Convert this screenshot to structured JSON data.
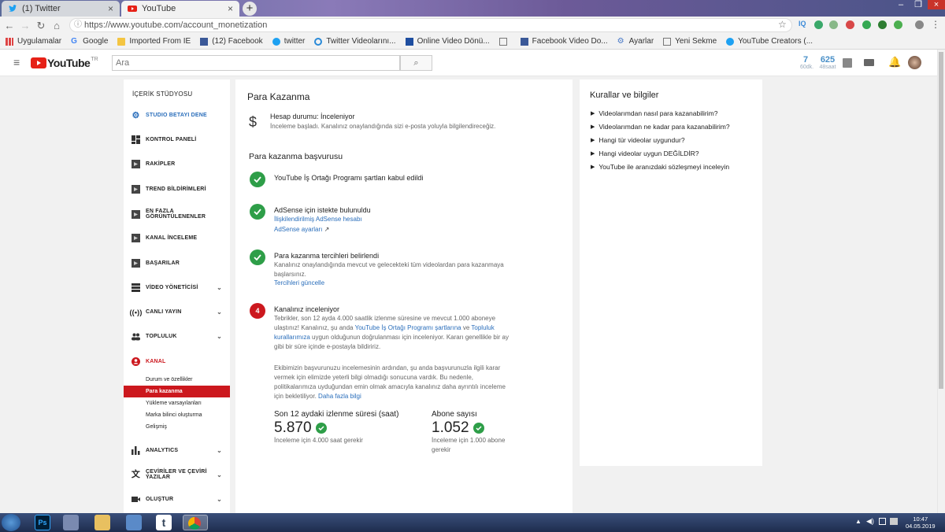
{
  "browser": {
    "tabs": [
      {
        "title": "(1) Twitter",
        "active": false
      },
      {
        "title": "YouTube",
        "active": true
      }
    ],
    "url": "https://www.youtube.com/account_monetization",
    "bookmarks": [
      "Uygulamalar",
      "Google",
      "Imported From IE",
      "(12) Facebook",
      "twitter",
      "Twitter Videolarını...",
      "Online Video Dönü...",
      "",
      "Facebook Video Do...",
      "Ayarlar",
      "Yeni Sekme",
      "YouTube Creators (..."
    ]
  },
  "yt": {
    "logo": "YouTube",
    "country": "TR",
    "search_placeholder": "Ara",
    "stats": [
      {
        "value": "7",
        "label": "60dk."
      },
      {
        "value": "625",
        "label": "48saat"
      }
    ]
  },
  "sidebar": {
    "heading": "İÇERİK STÜDYOSU",
    "items": [
      {
        "label": "STUDIO BETAYI DENE",
        "icon": "gear-icon"
      },
      {
        "label": "KONTROL PANELİ",
        "icon": "dashboard-icon"
      },
      {
        "label": "RAKİPLER",
        "icon": "video-thumb-icon"
      },
      {
        "label": "TREND BİLDİRİMLERİ",
        "icon": "video-thumb-icon"
      },
      {
        "label": "EN FAZLA GÖRÜNTÜLENENLER",
        "icon": "video-thumb-icon"
      },
      {
        "label": "KANAL İNCELEME",
        "icon": "video-thumb-icon"
      },
      {
        "label": "BAŞARILAR",
        "icon": "video-thumb-icon"
      },
      {
        "label": "VİDEO YÖNETİCİSİ",
        "icon": "list-icon"
      },
      {
        "label": "CANLI YAYIN",
        "icon": "broadcast-icon"
      },
      {
        "label": "TOPLULUK",
        "icon": "people-icon"
      },
      {
        "label": "KANAL",
        "icon": "account-icon"
      },
      {
        "label": "ANALYTICS",
        "icon": "bar-chart-icon"
      },
      {
        "label": "ÇEVİRİLER VE ÇEVİRİ YAZILAR",
        "icon": "translate-icon"
      },
      {
        "label": "OLUŞTUR",
        "icon": "camera-icon"
      }
    ],
    "kanal_sub": [
      "Durum ve özellikler",
      "Para kazanma",
      "Yükleme varsayılanları",
      "Marka bilinci oluşturma",
      "Gelişmiş"
    ]
  },
  "main": {
    "title": "Para Kazanma",
    "status_title": "Hesap durumu: İnceleniyor",
    "status_desc": "İnceleme başladı. Kanalınız onaylandığında sizi e-posta yoluyla bilgilendireceğiz.",
    "section_title": "Para kazanma başvurusu",
    "step1": "YouTube İş Ortağı Programı şartları kabul edildi",
    "step2_title": "AdSense için istekte bulunuldu",
    "step2_link1": "İlişkilendirilmiş AdSense hesabı",
    "step2_link2": "AdSense ayarları",
    "step3_title": "Para kazanma tercihleri belirlendi",
    "step3_desc": "Kanalınız onaylandığında mevcut ve gelecekteki tüm videolardan para kazanmaya başlarsınız.",
    "step3_link": "Tercihleri güncelle",
    "step4_num": "4",
    "step4_title": "Kanalınız inceleniyor",
    "step4_p1a": "Tebrikler, son 12 ayda 4.000 saatlik izlenme süresine ve mevcut 1.000 aboneye ulaştınız! Kanalınız, şu anda",
    "step4_p1_link1": "YouTube İş Ortağı Programı şartlarına",
    "step4_p1b": "ve",
    "step4_p1_link2": "Topluluk kurallarımıza",
    "step4_p1c": "uygun olduğunun doğrulanması için inceleniyor. Kararı genellikle bir ay gibi bir süre içinde e-postayla bildiririz.",
    "step4_p2": "Ekibimizin başvurunuzu incelemesinin ardından, şu anda başvurunuzla ilgili karar vermek için elimizde yeterli bilgi olmadığı sonucuna vardık. Bu nedenle, politikalarımıza uyduğundan emin olmak amacıyla kanalınız daha ayrıntılı inceleme için bekletiliyor.",
    "step4_p2_link": "Daha fazla bilgi",
    "metric1_label": "Son 12 aydaki izlenme süresi (saat)",
    "metric1_value": "5.870",
    "metric1_note": "İnceleme için 4.000 saat gerekir",
    "metric2_label": "Abone sayısı",
    "metric2_value": "1.052",
    "metric2_note": "İnceleme için 1.000 abone gerekir"
  },
  "rules": {
    "title": "Kurallar ve bilgiler",
    "items": [
      "Videolarımdan nasıl para kazanabilirim?",
      "Videolarımdan ne kadar para kazanabilirim?",
      "Hangi tür videolar uygundur?",
      "Hangi videolar uygun DEĞİLDİR?",
      "YouTube ile aranızdaki sözleşmeyi inceleyin"
    ]
  },
  "taskbar": {
    "time": "10:47",
    "date": "04.05.2019"
  },
  "colors": {
    "yt_red": "#cc181e",
    "check_green": "#2e9e48",
    "link_blue": "#2a6ebb"
  }
}
